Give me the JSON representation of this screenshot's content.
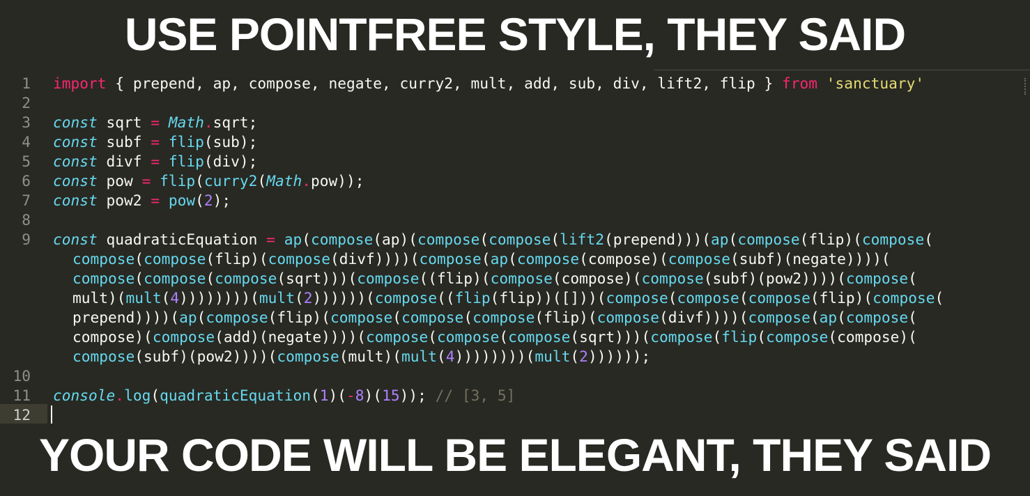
{
  "captions": {
    "top": "USE POINTFREE STYLE, THEY SAID",
    "bottom": "YOUR CODE WILL BE ELEGANT, THEY SAID"
  },
  "colors": {
    "background": "#282923",
    "keyword": "#f92672",
    "storage": "#66d9ef",
    "function": "#66d9ef",
    "string": "#e6db74",
    "number": "#ae81ff",
    "comment": "#75715e",
    "text": "#f8f8f2",
    "line_number": "#8f908a"
  },
  "editor": {
    "line_numbers": [
      "1",
      "2",
      "3",
      "4",
      "5",
      "6",
      "7",
      "8",
      "9",
      "10",
      "11",
      "12"
    ],
    "active_line": "12",
    "lines": [
      [
        [
          "kw",
          "import"
        ],
        [
          "t",
          " { prepend, ap, compose, negate, curry2, mult, add, sub, div, lift2, flip } "
        ],
        [
          "kw",
          "from"
        ],
        [
          "t",
          " "
        ],
        [
          "str",
          "'sanctuary'"
        ]
      ],
      [],
      [
        [
          "st",
          "const"
        ],
        [
          "t",
          " sqrt "
        ],
        [
          "op",
          "="
        ],
        [
          "t",
          " "
        ],
        [
          "st",
          "Math"
        ],
        [
          "op",
          "."
        ],
        [
          "t",
          "sqrt;"
        ]
      ],
      [
        [
          "st",
          "const"
        ],
        [
          "t",
          " subf "
        ],
        [
          "op",
          "="
        ],
        [
          "t",
          " "
        ],
        [
          "fn",
          "flip"
        ],
        [
          "t",
          "(sub);"
        ]
      ],
      [
        [
          "st",
          "const"
        ],
        [
          "t",
          " divf "
        ],
        [
          "op",
          "="
        ],
        [
          "t",
          " "
        ],
        [
          "fn",
          "flip"
        ],
        [
          "t",
          "(div);"
        ]
      ],
      [
        [
          "st",
          "const"
        ],
        [
          "t",
          " pow "
        ],
        [
          "op",
          "="
        ],
        [
          "t",
          " "
        ],
        [
          "fn",
          "flip"
        ],
        [
          "t",
          "("
        ],
        [
          "fn",
          "curry2"
        ],
        [
          "t",
          "("
        ],
        [
          "st",
          "Math"
        ],
        [
          "op",
          "."
        ],
        [
          "t",
          "pow));"
        ]
      ],
      [
        [
          "st",
          "const"
        ],
        [
          "t",
          " pow2 "
        ],
        [
          "op",
          "="
        ],
        [
          "t",
          " "
        ],
        [
          "fn",
          "pow"
        ],
        [
          "t",
          "("
        ],
        [
          "num",
          "2"
        ],
        [
          "t",
          ");"
        ]
      ],
      [],
      [
        [
          "st",
          "const"
        ],
        [
          "t",
          " quadraticEquation "
        ],
        [
          "op",
          "="
        ],
        [
          "t",
          " "
        ],
        [
          "fn",
          "ap"
        ],
        [
          "t",
          "("
        ],
        [
          "fn",
          "compose"
        ],
        [
          "t",
          "(ap)("
        ],
        [
          "fn",
          "compose"
        ],
        [
          "t",
          "("
        ],
        [
          "fn",
          "compose"
        ],
        [
          "t",
          "("
        ],
        [
          "fn",
          "lift2"
        ],
        [
          "t",
          "(prepend)))("
        ],
        [
          "fn",
          "ap"
        ],
        [
          "t",
          "("
        ],
        [
          "fn",
          "compose"
        ],
        [
          "t",
          "(flip)("
        ],
        [
          "fn",
          "compose"
        ],
        [
          "t",
          "("
        ]
      ],
      [
        [
          "fn",
          "compose"
        ],
        [
          "t",
          "("
        ],
        [
          "fn",
          "compose"
        ],
        [
          "t",
          "(flip)("
        ],
        [
          "fn",
          "compose"
        ],
        [
          "t",
          "(divf))))("
        ],
        [
          "fn",
          "compose"
        ],
        [
          "t",
          "("
        ],
        [
          "fn",
          "ap"
        ],
        [
          "t",
          "("
        ],
        [
          "fn",
          "compose"
        ],
        [
          "t",
          "(compose)("
        ],
        [
          "fn",
          "compose"
        ],
        [
          "t",
          "(subf)(negate))))("
        ]
      ],
      [
        [
          "fn",
          "compose"
        ],
        [
          "t",
          "("
        ],
        [
          "fn",
          "compose"
        ],
        [
          "t",
          "("
        ],
        [
          "fn",
          "compose"
        ],
        [
          "t",
          "(sqrt)))("
        ],
        [
          "fn",
          "compose"
        ],
        [
          "t",
          "((flip)("
        ],
        [
          "fn",
          "compose"
        ],
        [
          "t",
          "(compose)("
        ],
        [
          "fn",
          "compose"
        ],
        [
          "t",
          "(subf)(pow2))))("
        ],
        [
          "fn",
          "compose"
        ],
        [
          "t",
          "("
        ]
      ],
      [
        [
          "t",
          "mult)("
        ],
        [
          "fn",
          "mult"
        ],
        [
          "t",
          "("
        ],
        [
          "num",
          "4"
        ],
        [
          "t",
          "))))))))("
        ],
        [
          "fn",
          "mult"
        ],
        [
          "t",
          "("
        ],
        [
          "num",
          "2"
        ],
        [
          "t",
          "))))))("
        ],
        [
          "fn",
          "compose"
        ],
        [
          "t",
          "(("
        ],
        [
          "fn",
          "flip"
        ],
        [
          "t",
          "(flip))([]))("
        ],
        [
          "fn",
          "compose"
        ],
        [
          "t",
          "("
        ],
        [
          "fn",
          "compose"
        ],
        [
          "t",
          "("
        ],
        [
          "fn",
          "compose"
        ],
        [
          "t",
          "(flip)("
        ],
        [
          "fn",
          "compose"
        ],
        [
          "t",
          "("
        ]
      ],
      [
        [
          "t",
          "prepend))))("
        ],
        [
          "fn",
          "ap"
        ],
        [
          "t",
          "("
        ],
        [
          "fn",
          "compose"
        ],
        [
          "t",
          "(flip)("
        ],
        [
          "fn",
          "compose"
        ],
        [
          "t",
          "("
        ],
        [
          "fn",
          "compose"
        ],
        [
          "t",
          "("
        ],
        [
          "fn",
          "compose"
        ],
        [
          "t",
          "(flip)("
        ],
        [
          "fn",
          "compose"
        ],
        [
          "t",
          "(divf))))("
        ],
        [
          "fn",
          "compose"
        ],
        [
          "t",
          "("
        ],
        [
          "fn",
          "ap"
        ],
        [
          "t",
          "("
        ],
        [
          "fn",
          "compose"
        ],
        [
          "t",
          "("
        ]
      ],
      [
        [
          "t",
          "compose)("
        ],
        [
          "fn",
          "compose"
        ],
        [
          "t",
          "(add)(negate))))("
        ],
        [
          "fn",
          "compose"
        ],
        [
          "t",
          "("
        ],
        [
          "fn",
          "compose"
        ],
        [
          "t",
          "("
        ],
        [
          "fn",
          "compose"
        ],
        [
          "t",
          "(sqrt)))("
        ],
        [
          "fn",
          "compose"
        ],
        [
          "t",
          "("
        ],
        [
          "fn",
          "flip"
        ],
        [
          "t",
          "("
        ],
        [
          "fn",
          "compose"
        ],
        [
          "t",
          "(compose)("
        ]
      ],
      [
        [
          "fn",
          "compose"
        ],
        [
          "t",
          "(subf)(pow2))))("
        ],
        [
          "fn",
          "compose"
        ],
        [
          "t",
          "(mult)("
        ],
        [
          "fn",
          "mult"
        ],
        [
          "t",
          "("
        ],
        [
          "num",
          "4"
        ],
        [
          "t",
          "))))))))("
        ],
        [
          "fn",
          "mult"
        ],
        [
          "t",
          "("
        ],
        [
          "num",
          "2"
        ],
        [
          "t",
          "))))));"
        ]
      ],
      [],
      [
        [
          "st",
          "console"
        ],
        [
          "op",
          "."
        ],
        [
          "fn",
          "log"
        ],
        [
          "t",
          "("
        ],
        [
          "fn",
          "quadraticEquation"
        ],
        [
          "t",
          "("
        ],
        [
          "num",
          "1"
        ],
        [
          "t",
          ")("
        ],
        [
          "op",
          "-"
        ],
        [
          "num",
          "8"
        ],
        [
          "t",
          ")("
        ],
        [
          "num",
          "15"
        ],
        [
          "t",
          "));"
        ],
        [
          "t",
          " "
        ],
        [
          "cm",
          "// [3, 5]"
        ]
      ],
      []
    ]
  }
}
